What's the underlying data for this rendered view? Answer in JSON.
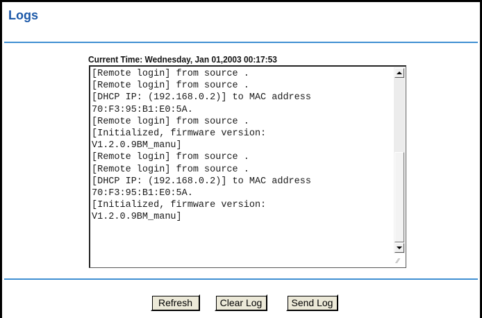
{
  "page": {
    "title": "Logs",
    "current_time": "Current Time: Wednesday, Jan 01,2003 00:17:53"
  },
  "log": {
    "text": "[Remote login] from source .\n[Remote login] from source .\n[DHCP IP: (192.168.0.2)] to MAC address\n70:F3:95:B1:E0:5A.\n[Remote login] from source .\n[Initialized, firmware version:\nV1.2.0.9BM_manu]\n[Remote login] from source .\n[Remote login] from source .\n[DHCP IP: (192.168.0.2)] to MAC address\n70:F3:95:B1:E0:5A.\n[Initialized, firmware version:\nV1.2.0.9BM_manu]"
  },
  "buttons": {
    "refresh": "Refresh",
    "clear_log": "Clear Log",
    "send_log": "Send Log"
  },
  "colors": {
    "title": "#1b58a8",
    "rule": "#3f8fd2",
    "button_face": "#ece9d8"
  },
  "icons": [
    "scroll-up-icon",
    "scroll-down-icon",
    "resize-grip-icon"
  ]
}
